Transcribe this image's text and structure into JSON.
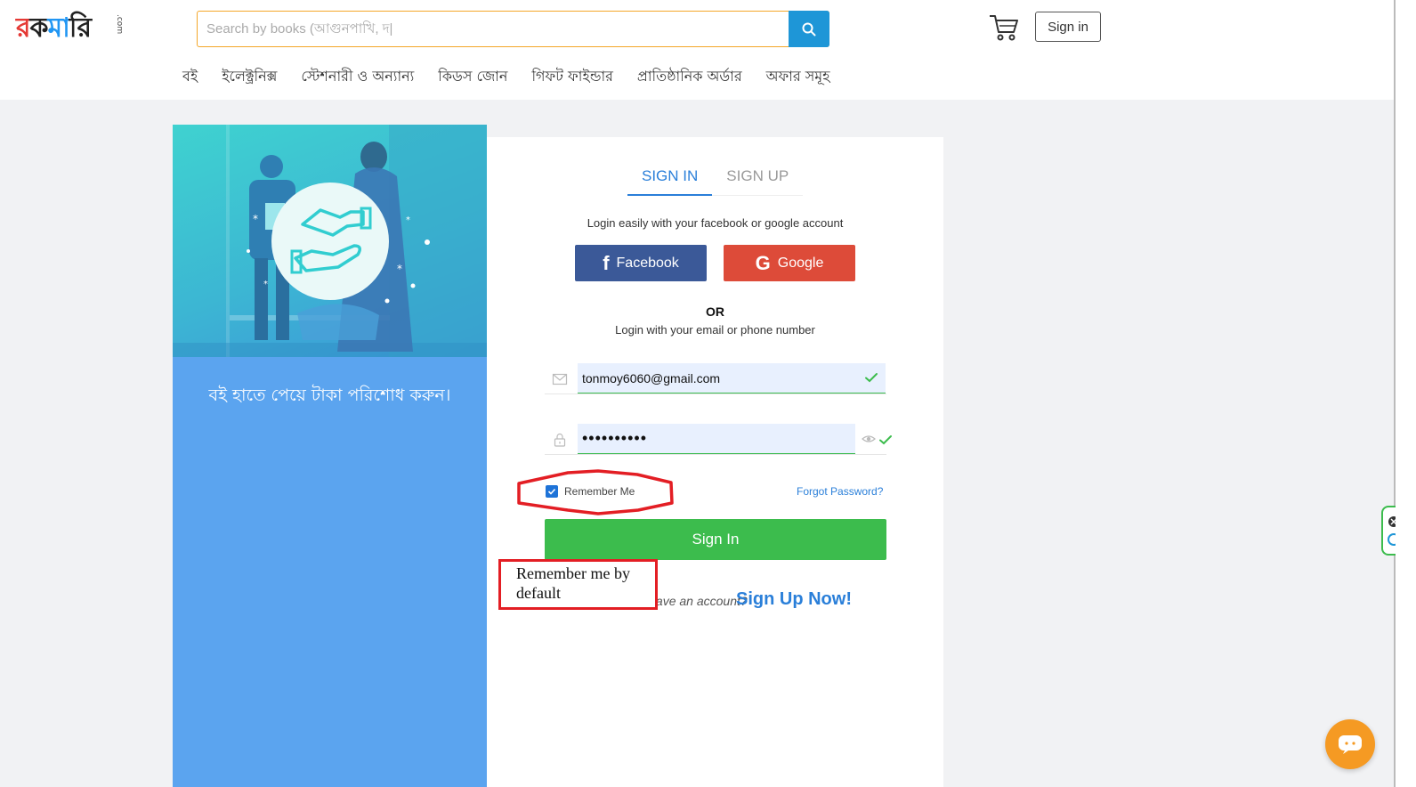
{
  "header": {
    "logo": {
      "part1": "র",
      "part2": "ক",
      "part3": "মা",
      "part4": "রি",
      "suffix": ".com"
    },
    "search": {
      "placeholder": "Search by books (আগুনপাখি, দ|"
    },
    "signin_label": "Sign in"
  },
  "nav": {
    "items": [
      {
        "label": "বই"
      },
      {
        "label": "ইলেক্ট্রনিক্স"
      },
      {
        "label": "স্টেশনারী ও অন্যান্য"
      },
      {
        "label": "কিডস জোন"
      },
      {
        "label": "গিফট ফাইন্ডার"
      },
      {
        "label": "প্রাতিষ্ঠানিক অর্ডার"
      },
      {
        "label": "অফার সমূহ"
      }
    ]
  },
  "promo": {
    "text": "বই হাতে পেয়ে টাকা পরিশোধ করুন।"
  },
  "auth": {
    "tabs": [
      {
        "label": "SIGN IN"
      },
      {
        "label": "SIGN UP"
      }
    ],
    "social_hint": "Login easily with your facebook or google account",
    "facebook_label": "Facebook",
    "facebook_glyph": "f",
    "google_label": "Google",
    "google_glyph": "G",
    "or": "OR",
    "email_hint": "Login with your email or phone number",
    "email_value": "tonmoy6060@gmail.com",
    "password_value": "••••••••••",
    "remember_label": "Remember Me",
    "remember_checked": true,
    "forgot_label": "Forgot Password?",
    "signin_label": "Sign In",
    "no_account": "Don't have an account?",
    "signup_label": "Sign Up Now!"
  },
  "annotation": {
    "line1": "Remember me by",
    "line2": "default"
  },
  "colors": {
    "search_button": "#1e96d7",
    "facebook": "#3b5998",
    "google": "#dd4b39",
    "signin_button": "#3cbc4d",
    "annotation": "#e31e24",
    "promo_panel": "#5ba4ef",
    "chat_button": "#f59a23"
  }
}
